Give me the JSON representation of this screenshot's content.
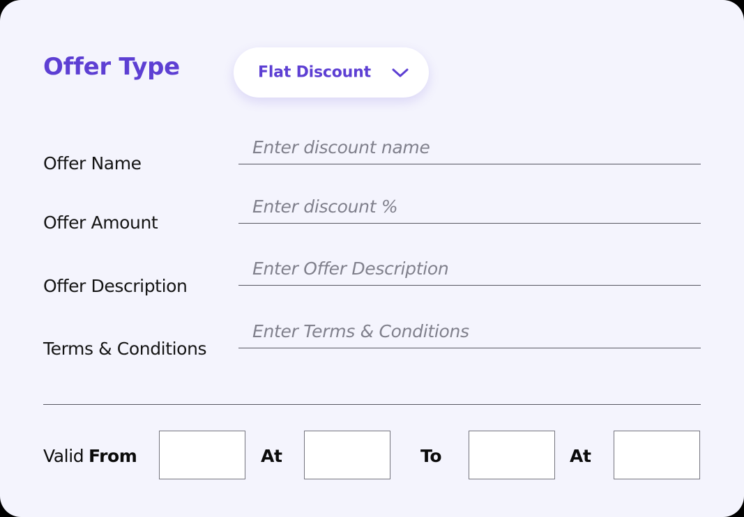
{
  "theme": {
    "card_bg": "#F4F4FD",
    "accent_purple": "#5D3FD3",
    "label_color": "#141414",
    "placeholder_color": "#80808C",
    "line_color": "#55555F",
    "box_border": "#73737D",
    "box_fill": "#FFFFFF",
    "page_bg": "#000000"
  },
  "header": {
    "title": "Offer Type",
    "dropdown": {
      "selected": "Flat Discount",
      "icon": "chevron-down-icon"
    }
  },
  "form": {
    "rows": [
      {
        "label": "Offer Name",
        "placeholder": "Enter discount name",
        "value": ""
      },
      {
        "label": "Offer Amount",
        "placeholder": "Enter discount %",
        "value": ""
      },
      {
        "label": "Offer Description",
        "placeholder": "Enter Offer Description",
        "value": ""
      },
      {
        "label": "Terms & Conditions",
        "placeholder": "Enter Terms & Conditions",
        "value": ""
      }
    ]
  },
  "validity": {
    "valid_word": "Valid",
    "from_word": "From",
    "at_word_1": "At",
    "to_word": "To",
    "at_word_2": "At",
    "boxes": [
      {
        "name": "from-date",
        "value": "",
        "placeholder": ""
      },
      {
        "name": "from-time",
        "value": "",
        "placeholder": ""
      },
      {
        "name": "to-date",
        "value": "",
        "placeholder": ""
      },
      {
        "name": "to-time",
        "value": "",
        "placeholder": ""
      }
    ]
  }
}
